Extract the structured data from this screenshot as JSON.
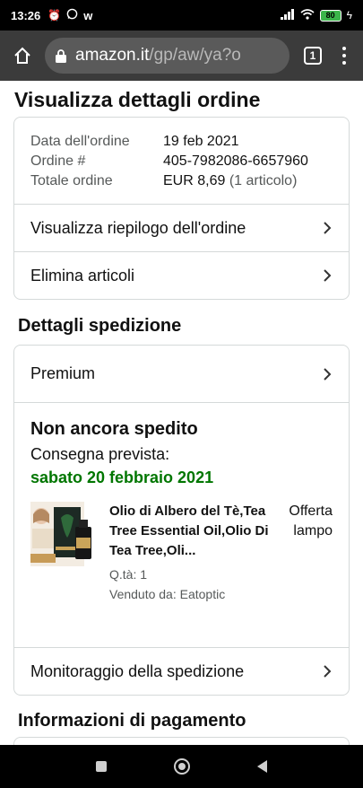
{
  "status_bar": {
    "time": "13:26",
    "app_glyph": "w",
    "battery": "80"
  },
  "browser": {
    "url_host": "amazon.it",
    "url_path": "/gp/aw/ya?o",
    "tab_count": "1"
  },
  "page": {
    "title": "Visualizza dettagli ordine"
  },
  "order": {
    "date_label": "Data dell'ordine",
    "date_value": "19 feb 2021",
    "number_label": "Ordine #",
    "number_value": "405-7982086-6657960",
    "total_label": "Totale ordine",
    "total_value": "EUR 8,69",
    "total_count": "(1 articolo)",
    "actions": [
      {
        "label": "Visualizza riepilogo dell'ordine"
      },
      {
        "label": "Elimina articoli"
      }
    ]
  },
  "shipping": {
    "section_title": "Dettagli spedizione",
    "method": "Premium",
    "status": "Non ancora spedito",
    "expected_label": "Consegna prevista:",
    "expected_date": "sabato 20 febbraio 2021",
    "item": {
      "title": "Olio di Albero del Tè,Tea Tree Essential Oil,Olio Di Tea Tree,Oli...",
      "badge": "Offerta lampo",
      "quantity": "Q.tà: 1",
      "seller": "Venduto da: Eatoptic"
    },
    "tracking_label": "Monitoraggio della spedizione"
  },
  "payment": {
    "section_title": "Informazioni di pagamento"
  },
  "colors": {
    "delivery_green": "#007600",
    "border": "#d5d9d9",
    "muted_text": "#565959"
  }
}
